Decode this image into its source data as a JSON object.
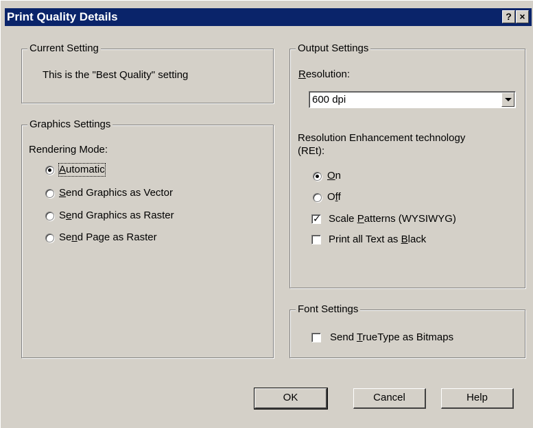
{
  "window": {
    "title": "Print Quality Details",
    "help_glyph": "?",
    "close_glyph": "×"
  },
  "current_setting": {
    "legend": "Current Setting",
    "text": "This is the \"Best Quality\" setting"
  },
  "graphics_settings": {
    "legend": "Graphics Settings",
    "rendering_mode_label": "Rendering Mode:",
    "options": [
      {
        "pre": "",
        "key": "A",
        "post": "utomatic",
        "selected": true
      },
      {
        "pre": "",
        "key": "S",
        "post": "end Graphics as Vector",
        "selected": false
      },
      {
        "pre": "S",
        "key": "e",
        "post": "nd Graphics as Raster",
        "selected": false
      },
      {
        "pre": "Se",
        "key": "n",
        "post": "d Page as Raster",
        "selected": false
      }
    ]
  },
  "output_settings": {
    "legend": "Output Settings",
    "resolution_label_key": "R",
    "resolution_label_rest": "esolution:",
    "resolution_value": "600 dpi",
    "ret_label_line1": "Resolution Enhancement technology",
    "ret_label_line2": "(REt):",
    "ret_on": {
      "key": "O",
      "rest": "n",
      "selected": true
    },
    "ret_off": {
      "pre": "O",
      "key": "f",
      "rest": "f",
      "selected": false
    },
    "scale_patterns": {
      "pre": "Scale ",
      "key": "P",
      "rest": "atterns (WYSIWYG)",
      "checked": true
    },
    "print_black": {
      "pre": "Print all Text as ",
      "key": "B",
      "rest": "lack",
      "checked": false
    }
  },
  "font_settings": {
    "legend": "Font Settings",
    "truetype": {
      "pre": "Send ",
      "key": "T",
      "rest": "rueType as Bitmaps",
      "checked": false
    }
  },
  "buttons": {
    "ok": "OK",
    "cancel": "Cancel",
    "help": "Help"
  },
  "colors": {
    "titlebar": "#0a246a",
    "face": "#d4d0c8"
  }
}
